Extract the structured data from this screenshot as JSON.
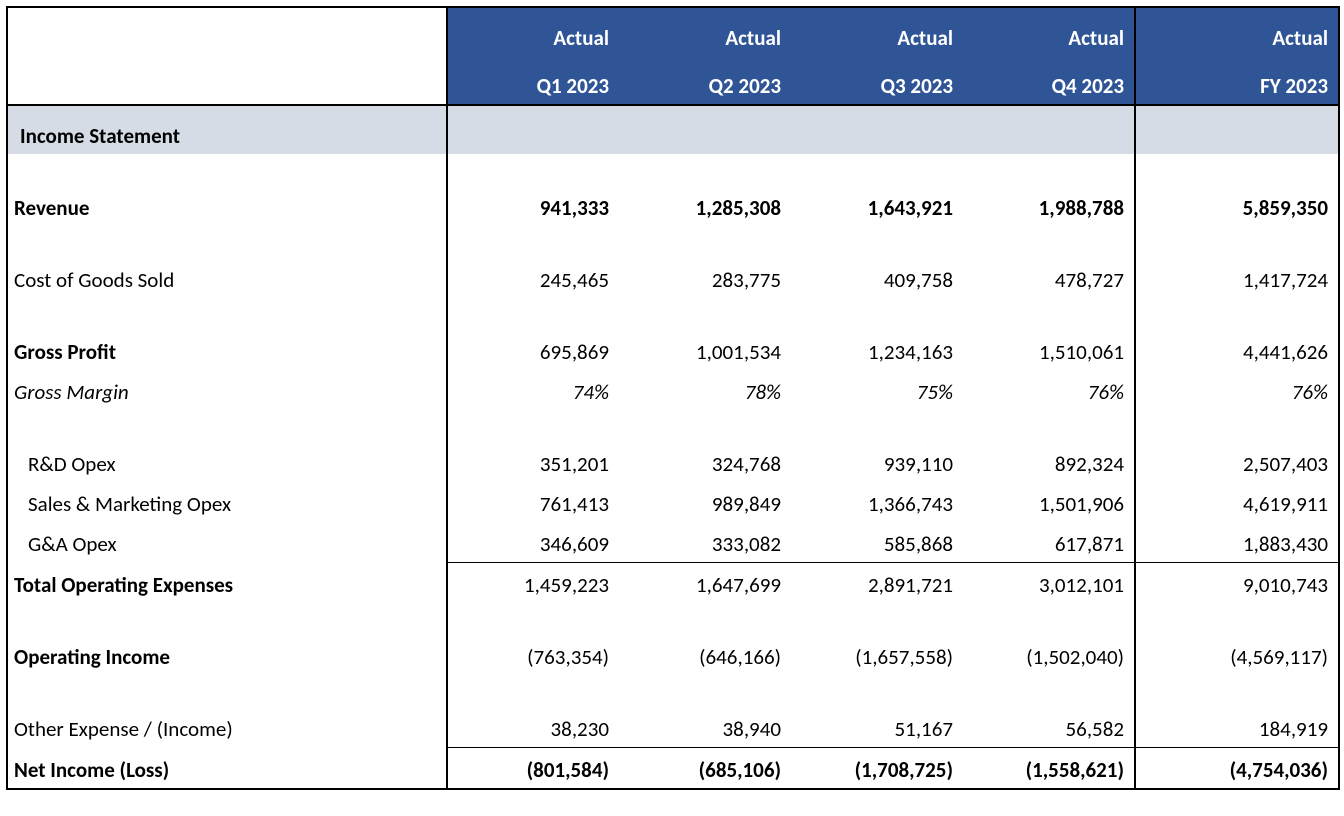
{
  "columns": {
    "header_top": "Actual",
    "q1": "Q1 2023",
    "q2": "Q2 2023",
    "q3": "Q3 2023",
    "q4": "Q4 2023",
    "fy": "FY 2023"
  },
  "section": "Income Statement",
  "rows": {
    "revenue": {
      "label": "Revenue",
      "q1": "941,333",
      "q2": "1,285,308",
      "q3": "1,643,921",
      "q4": "1,988,788",
      "fy": "5,859,350"
    },
    "cogs": {
      "label": "Cost of Goods Sold",
      "q1": "245,465",
      "q2": "283,775",
      "q3": "409,758",
      "q4": "478,727",
      "fy": "1,417,724"
    },
    "gross_profit": {
      "label": "Gross Profit",
      "q1": "695,869",
      "q2": "1,001,534",
      "q3": "1,234,163",
      "q4": "1,510,061",
      "fy": "4,441,626"
    },
    "gross_margin": {
      "label": "Gross Margin",
      "q1": "74%",
      "q2": "78%",
      "q3": "75%",
      "q4": "76%",
      "fy": "76%"
    },
    "rd": {
      "label": "R&D Opex",
      "q1": "351,201",
      "q2": "324,768",
      "q3": "939,110",
      "q4": "892,324",
      "fy": "2,507,403"
    },
    "sm": {
      "label": "Sales & Marketing Opex",
      "q1": "761,413",
      "q2": "989,849",
      "q3": "1,366,743",
      "q4": "1,501,906",
      "fy": "4,619,911"
    },
    "ga": {
      "label": "G&A Opex",
      "q1": "346,609",
      "q2": "333,082",
      "q3": "585,868",
      "q4": "617,871",
      "fy": "1,883,430"
    },
    "total_opex": {
      "label": "Total Operating Expenses",
      "q1": "1,459,223",
      "q2": "1,647,699",
      "q3": "2,891,721",
      "q4": "3,012,101",
      "fy": "9,010,743"
    },
    "op_income": {
      "label": "Operating Income",
      "q1": "(763,354)",
      "q2": "(646,166)",
      "q3": "(1,657,558)",
      "q4": "(1,502,040)",
      "fy": "(4,569,117)"
    },
    "other_exp": {
      "label": "Other Expense / (Income)",
      "q1": "38,230",
      "q2": "38,940",
      "q3": "51,167",
      "q4": "56,582",
      "fy": "184,919"
    },
    "net_income": {
      "label": "Net Income (Loss)",
      "q1": "(801,584)",
      "q2": "(685,106)",
      "q3": "(1,708,725)",
      "q4": "(1,558,621)",
      "fy": "(4,754,036)"
    }
  }
}
